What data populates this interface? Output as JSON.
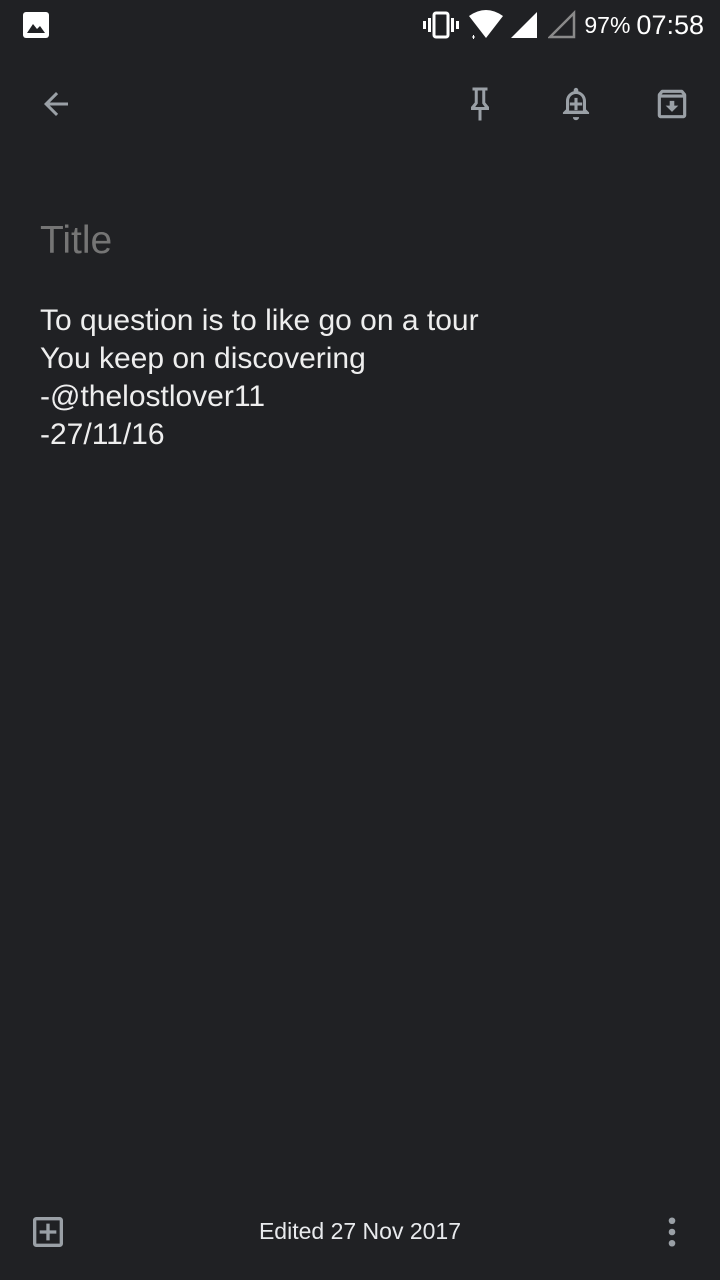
{
  "status_bar": {
    "left_icon": "image-notification-icon",
    "icons": [
      "vibrate-icon",
      "wifi-icon",
      "signal-icon",
      "signal-empty-icon"
    ],
    "battery": "97%",
    "time": "07:58"
  },
  "app_bar": {
    "back_icon": "arrow-back-icon",
    "pin_icon": "pin-icon",
    "reminder_icon": "add-reminder-icon",
    "archive_icon": "archive-icon"
  },
  "note": {
    "title_placeholder": "Title",
    "title_value": "",
    "lines": [
      "To question is to like go on a tour",
      "You keep on discovering",
      "-@thelostlover11",
      "-27/11/16"
    ]
  },
  "bottom_bar": {
    "add_icon": "add-box-icon",
    "edited": "Edited 27 Nov 2017",
    "more_icon": "more-vert-icon"
  },
  "colors": {
    "background": "#202124",
    "icon": "#9aa0a6",
    "text": "#e8eaed",
    "placeholder": "#7b7e82"
  }
}
